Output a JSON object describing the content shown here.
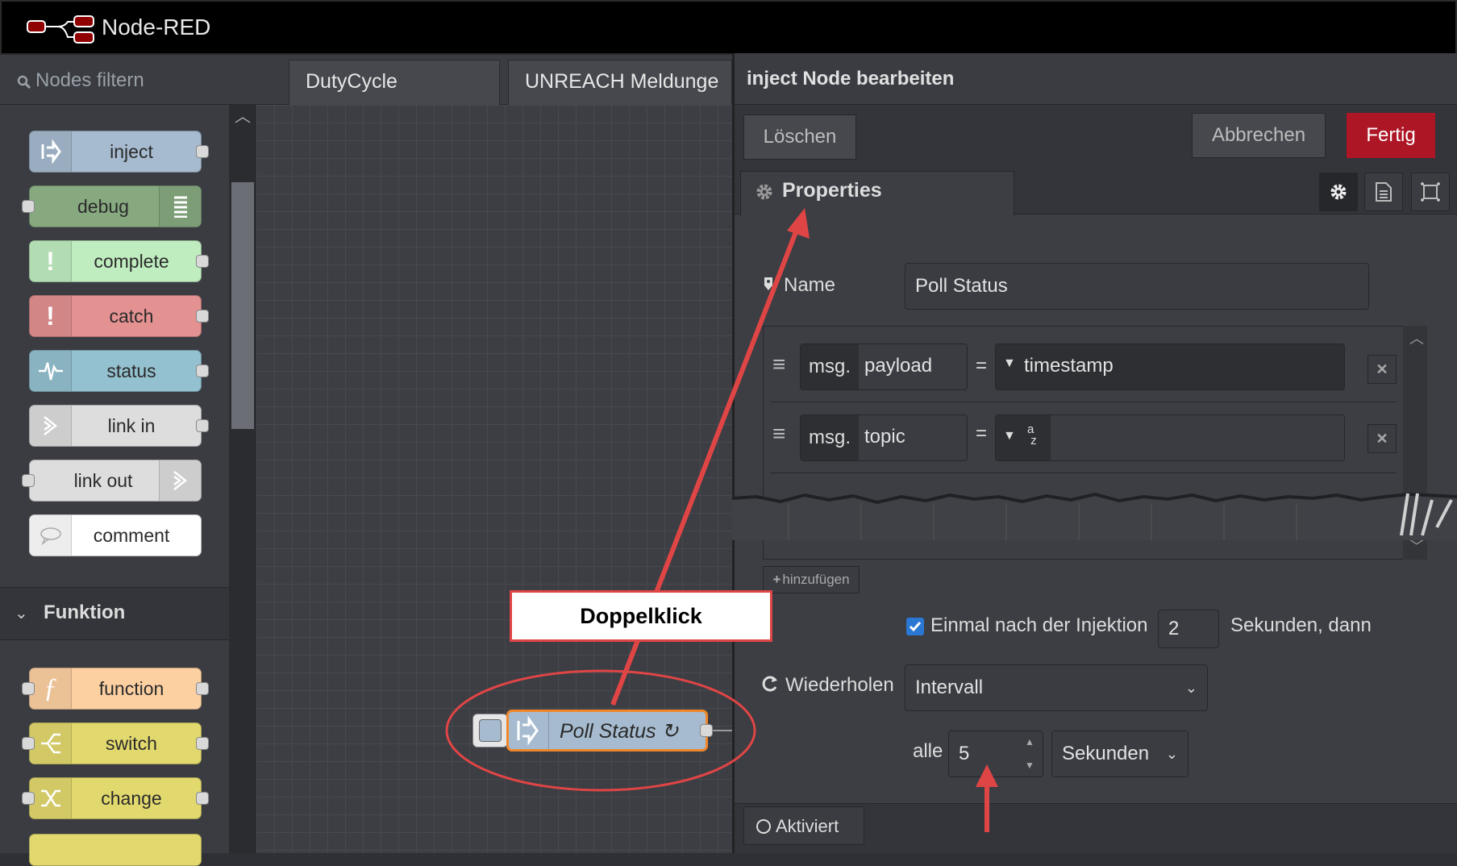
{
  "app": {
    "title": "Node-RED"
  },
  "palette": {
    "filter_placeholder": "Nodes filtern",
    "nodes": [
      {
        "label": "inject",
        "color": "#a6bbcf"
      },
      {
        "label": "debug",
        "color": "#87a980"
      },
      {
        "label": "complete",
        "color": "#c0edc0"
      },
      {
        "label": "catch",
        "color": "#e49191"
      },
      {
        "label": "status",
        "color": "#94c1d0"
      },
      {
        "label": "link in",
        "color": "#dddddd"
      },
      {
        "label": "link out",
        "color": "#dddddd"
      },
      {
        "label": "comment",
        "color": "#ffffff"
      }
    ],
    "category": "Funktion",
    "function_nodes": [
      {
        "label": "function",
        "color": "#fdd0a2"
      },
      {
        "label": "switch",
        "color": "#e2d96e"
      },
      {
        "label": "change",
        "color": "#e2d96e"
      }
    ]
  },
  "workspace": {
    "tabs": [
      "DutyCycle",
      "UNREACH Meldunge"
    ],
    "node": {
      "label": "Poll Status ↻",
      "color": "#a6bbcf",
      "selected_border": "#f0872b"
    }
  },
  "editor": {
    "title": "inject Node bearbeiten",
    "delete_label": "Löschen",
    "cancel_label": "Abbrechen",
    "done_label": "Fertig",
    "tab_label": "Properties",
    "name_label": "Name",
    "name_value": "Poll Status",
    "properties": [
      {
        "prefix": "msg.",
        "key": "payload",
        "eq": "=",
        "value": "timestamp"
      },
      {
        "prefix": "msg.",
        "key": "topic",
        "eq": "=",
        "value": "",
        "type_icon": "az"
      }
    ],
    "add_label": "hinzufügen",
    "once_checked": true,
    "once_label": "Einmal nach der Injektion",
    "once_value": "2",
    "once_suffix": "Sekunden, dann",
    "repeat_label": "Wiederholen",
    "repeat_value": "Intervall",
    "every_label": "alle",
    "every_value": "5",
    "unit_value": "Sekunden",
    "enabled_label": "Aktiviert"
  },
  "annotation": {
    "callout": "Doppelklick",
    "color": "#e04545"
  }
}
